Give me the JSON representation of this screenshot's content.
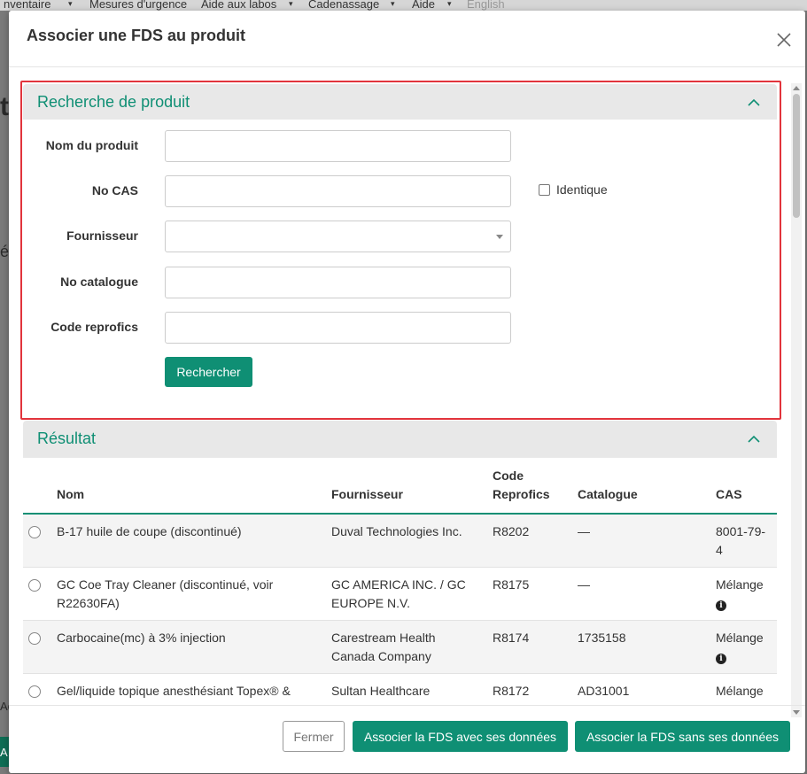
{
  "background": {
    "nav_items": [
      "nventaire",
      "Mesures d'urgence",
      "Aide aux labos",
      "Cadenassage",
      "Aide",
      "English"
    ],
    "fragments": [
      "t",
      "é",
      "Ac",
      "A"
    ]
  },
  "modal": {
    "title": "Associer une FDS au produit",
    "close_label": "×"
  },
  "search_panel": {
    "title": "Recherche de produit",
    "fields": {
      "product_name_label": "Nom du produit",
      "product_name_value": "",
      "cas_label": "No CAS",
      "cas_value": "",
      "identical_label": "Identique",
      "supplier_label": "Fournisseur",
      "supplier_value": "",
      "catalog_label": "No catalogue",
      "catalog_value": "",
      "reprofics_label": "Code reprofics",
      "reprofics_value": ""
    },
    "search_button": "Rechercher"
  },
  "result_panel": {
    "title": "Résultat",
    "columns": {
      "name": "Nom",
      "supplier": "Fournisseur",
      "code_line1": "Code",
      "code_line2": "Reprofics",
      "catalog": "Catalogue",
      "cas": "CAS"
    },
    "rows": [
      {
        "name": "B-17 huile de coupe (discontinué)",
        "supplier": "Duval Technologies Inc.",
        "code": "R8202",
        "catalog": "—",
        "cas": "8001-79-4",
        "info": false
      },
      {
        "name": "GC Coe Tray Cleaner (discontinué, voir R22630FA)",
        "supplier": "GC AMERICA INC. / GC EUROPE N.V.",
        "code": "R8175",
        "catalog": "—",
        "cas": "Mélange",
        "info": true
      },
      {
        "name": "Carbocaine(mc) à 3% injection",
        "supplier": "Carestream Health Canada Company",
        "code": "R8174",
        "catalog": "1735158",
        "cas": "Mélange",
        "info": true
      },
      {
        "name": "Gel/liquide topique anesthésiant Topex® & HandiCaine Stix®",
        "supplier": "Sultan Healthcare",
        "code": "R8172",
        "catalog": "AD31001",
        "cas": "Mélange",
        "info": true
      }
    ]
  },
  "footer": {
    "close_button": "Fermer",
    "associate_with_data": "Associer la FDS avec ses données",
    "associate_without_data": "Associer la FDS sans ses données"
  },
  "colors": {
    "accent": "#0f8f74",
    "highlight": "#e2343c"
  }
}
